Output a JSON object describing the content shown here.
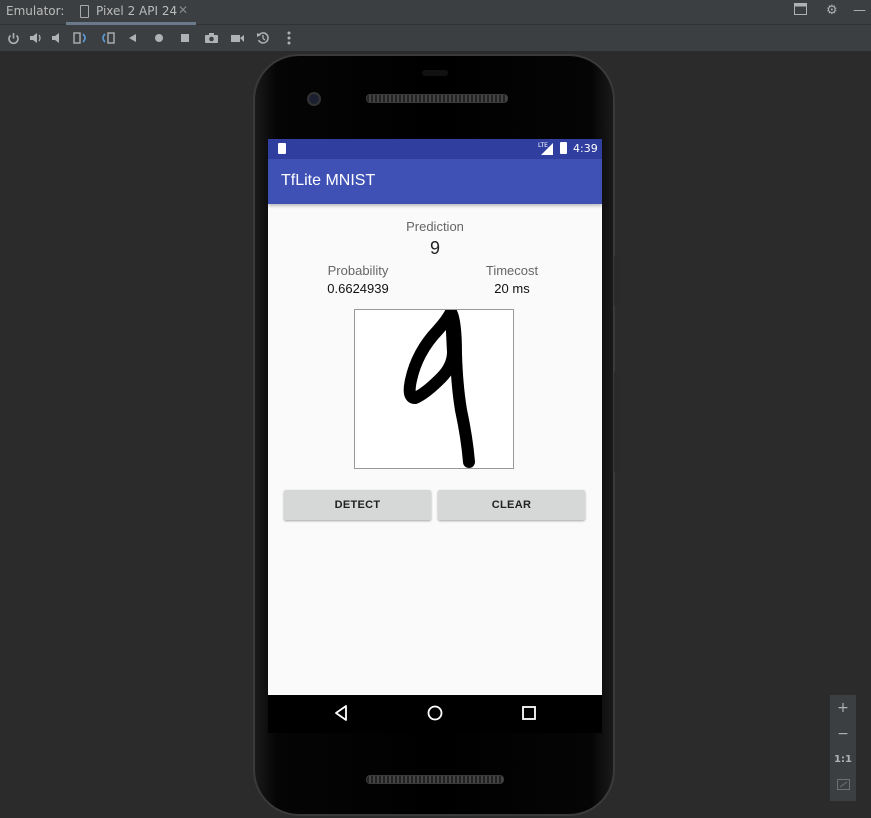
{
  "ide": {
    "emulator_label": "Emulator:",
    "tab_label": "Pixel 2 API 24",
    "tab_close": "✕"
  },
  "toolbar": {
    "icons": [
      "power-icon",
      "volume-up-icon",
      "volume-down-icon",
      "rotate-left-icon",
      "rotate-right-icon",
      "back-icon",
      "home-icon",
      "overview-icon",
      "screenshot-icon",
      "screenrecord-icon",
      "snapshot-icon",
      "more-icon"
    ]
  },
  "device": {
    "status": {
      "network": "LTE",
      "time": "4:39"
    },
    "app_title": "TfLite MNIST",
    "prediction": {
      "label": "Prediction",
      "value": "9"
    },
    "probability": {
      "label": "Probability",
      "value": "0.6624939"
    },
    "timecost": {
      "label": "Timecost",
      "value": "20 ms"
    },
    "buttons": {
      "detect": "DETECT",
      "clear": "CLEAR"
    },
    "drawn_digit": "9"
  },
  "zoom": {
    "plus": "+",
    "minus": "−",
    "one_to_one": "1:1"
  },
  "colors": {
    "status_bar": "#303f9f",
    "app_bar": "#3f51b5",
    "ide_background": "#2b2b2b",
    "ide_panel": "#3c3f41",
    "button": "#d6d7d7"
  }
}
